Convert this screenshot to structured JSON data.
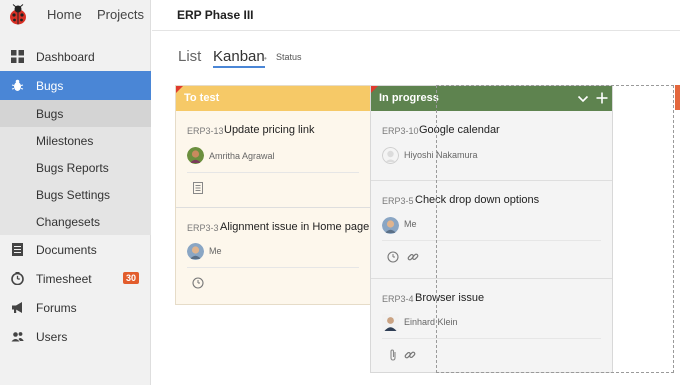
{
  "topnav": {
    "home": "Home",
    "projects": "Projects"
  },
  "project": {
    "title": "ERP Phase III"
  },
  "sidebar": {
    "items": [
      {
        "label": "Dashboard",
        "icon": "dashboard-icon"
      },
      {
        "label": "Bugs",
        "icon": "bug-icon",
        "active": true
      },
      {
        "label": "Bugs",
        "sub": true,
        "selected": true
      },
      {
        "label": "Milestones",
        "sub": true
      },
      {
        "label": "Bugs Reports",
        "sub": true
      },
      {
        "label": "Bugs Settings",
        "sub": true
      },
      {
        "label": "Changesets",
        "sub": true
      },
      {
        "label": "Documents",
        "icon": "documents-icon"
      },
      {
        "label": "Timesheet",
        "icon": "clock-icon",
        "badge": "30"
      },
      {
        "label": "Forums",
        "icon": "megaphone-icon"
      },
      {
        "label": "Users",
        "icon": "users-icon"
      }
    ]
  },
  "view": {
    "list_tab": "List",
    "kanban_tab": "Kanban",
    "dot": "•",
    "status_label": "Status"
  },
  "columns": {
    "to_test": {
      "title": "To test",
      "cards": [
        {
          "id": "ERP3-13",
          "title": "Update pricing link",
          "assignee": "Amritha Agrawal"
        },
        {
          "id": "ERP3-3",
          "title": "Alignment issue in Home page",
          "assignee": "Me"
        }
      ]
    },
    "in_progress": {
      "title": "In progress",
      "cards": [
        {
          "id": "ERP3-10",
          "title": "Google calendar",
          "assignee": "Hiyoshi Nakamura"
        },
        {
          "id": "ERP3-5",
          "title": "Check drop down options",
          "assignee": "Me"
        },
        {
          "id": "ERP3-4",
          "title": "Browser issue",
          "assignee": "Einhard Klein"
        }
      ]
    }
  },
  "colors": {
    "accent": "#4a86d6",
    "to_test_header": "#f6c967",
    "in_progress_header": "#5e834f",
    "badge": "#e25c2c"
  }
}
